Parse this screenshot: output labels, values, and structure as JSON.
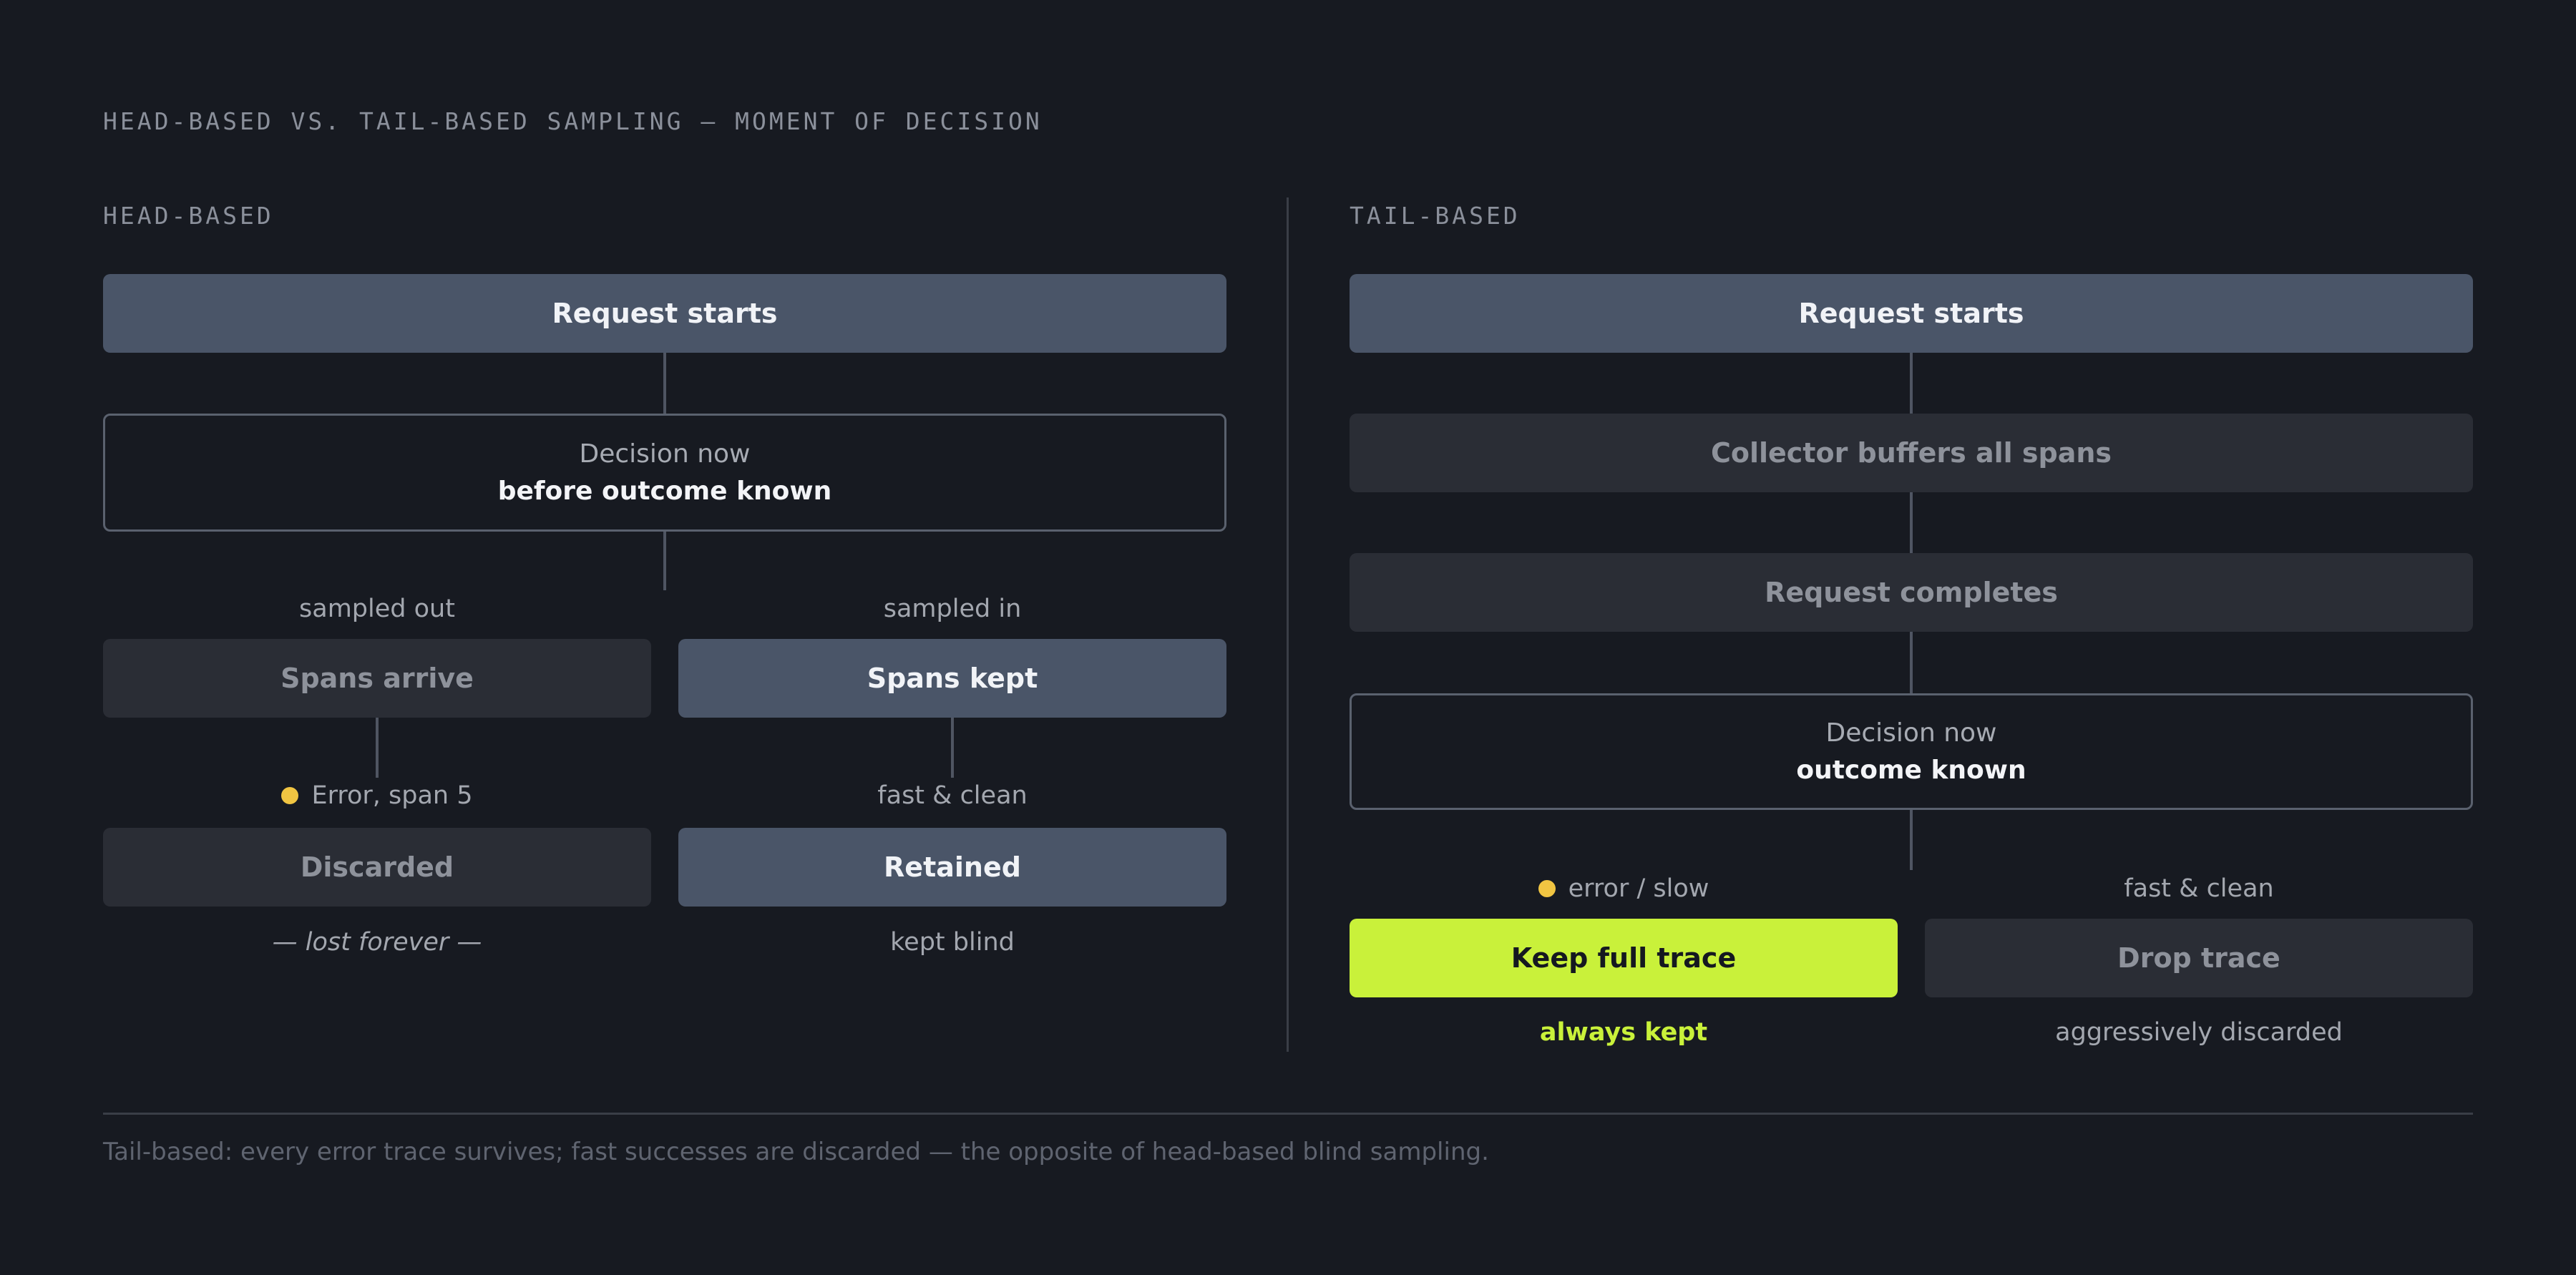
{
  "title": "HEAD-BASED VS. TAIL-BASED SAMPLING — MOMENT OF DECISION",
  "head": {
    "heading": "HEAD-BASED",
    "request_starts": "Request starts",
    "decision_line1": "Decision now",
    "decision_line2": "before outcome known",
    "left_branch_label": "sampled out",
    "right_branch_label": "sampled in",
    "spans_arrive": "Spans arrive",
    "spans_kept": "Spans kept",
    "error_label": "Error, span 5",
    "fast_clean_label": "fast & clean",
    "discarded": "Discarded",
    "retained": "Retained",
    "lost_forever": "— lost forever —",
    "kept_blind": "kept blind"
  },
  "tail": {
    "heading": "TAIL-BASED",
    "request_starts": "Request starts",
    "collector_buffers": "Collector buffers all spans",
    "request_completes": "Request completes",
    "decision_line1": "Decision now",
    "decision_line2": "outcome known",
    "error_slow_label": "error / slow",
    "fast_clean_label": "fast & clean",
    "keep_full_trace": "Keep full trace",
    "drop_trace": "Drop trace",
    "always_kept": "always kept",
    "aggressively_discarded": "aggressively discarded"
  },
  "footer": "Tail-based: every error trace survives; fast successes are discarded — the opposite of head-based blind sampling.",
  "colors": {
    "background": "#171a21",
    "primary_box": "#4a5568",
    "muted_box": "#2a2d35",
    "accent": "#c9f13a",
    "error_dot": "#f1c542"
  }
}
